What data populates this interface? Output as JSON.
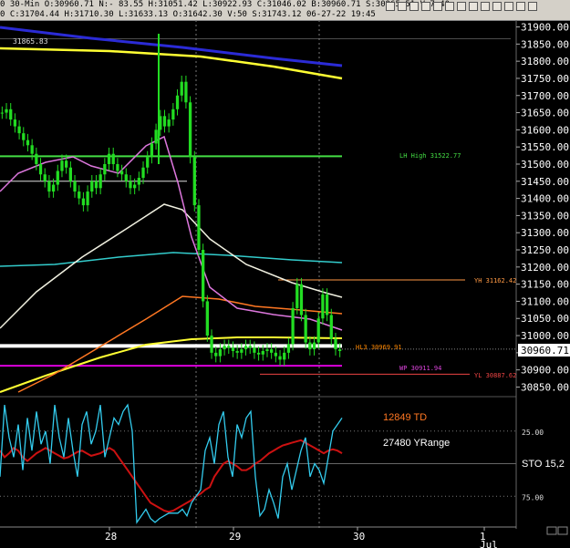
{
  "toolbar": {
    "quote_line": "0 30-Min O:30960.71 N:- 83.55 H:31051.42 L:30922.93 C:31046.02 B:30960.71 S:30965.51 V:7.40",
    "info_line": "0 C:31704.44 H:31710.30 L:31633.13 O:31642.30 V:50 S:31743.12 06-27-22 19:45",
    "icons": [
      "zoom-icon",
      "toggle-icon",
      "draw-icon",
      "color-icon",
      "check-icon",
      "clock-icon",
      "grid-icon",
      "text-icon",
      "cross-icon",
      "arrow-icon",
      "line-icon",
      "x-icon",
      "settings-icon"
    ]
  },
  "annotations": {
    "top_left_price": "31865.83",
    "lh_high": "LH High 31522.77",
    "yh": "YH 31162.42",
    "hl3": "HL3 30969.91",
    "wp": "WP 30911.94",
    "yl": "YL 30887.62",
    "td": "12849 TD",
    "yrange": "27480 YRange",
    "sto": "STO 15,2",
    "current_price": "30960.71"
  },
  "lower_ticks": [
    "25.00",
    "75.00"
  ],
  "x_labels": [
    "28",
    "29",
    "30",
    "1",
    "Jul"
  ],
  "colors": {
    "background": "#000000",
    "candle": "#22dd22",
    "blue_ma": "#2b2bd6",
    "yellow_ma": "#ffff33",
    "cyan_line": "#33cccc",
    "orange_ma": "#ff7722",
    "white_ma": "#f0f0e0",
    "pink_ma": "#dd77dd",
    "green_level": "#44dd44",
    "magenta_level": "#dd00dd",
    "hl3_orange": "#ff8800",
    "stoch_fast": "#33ccee",
    "stoch_slow": "#cc1111",
    "td_text": "#ff7722"
  },
  "chart_data": {
    "type": "line",
    "title": "",
    "y_ticks": [
      30850,
      30900,
      30950,
      31000,
      31050,
      31100,
      31150,
      31200,
      31250,
      31300,
      31350,
      31400,
      31450,
      31500,
      31550,
      31600,
      31650,
      31700,
      31750,
      31800,
      31850,
      31900
    ],
    "ylim": [
      30830,
      31920
    ],
    "x_categories": [
      "28",
      "29",
      "30",
      "1"
    ],
    "series": [
      {
        "kind": "close",
        "values": [
          31650,
          31660,
          31630,
          31610,
          31590,
          31570,
          31555,
          31530,
          31500,
          31470,
          31450,
          31420,
          31440,
          31480,
          31510,
          31490,
          31450,
          31420,
          31400,
          31380,
          31420,
          31450,
          31430,
          31470,
          31500,
          31530,
          31500,
          31480,
          31470,
          31450,
          31430,
          31440,
          31460,
          31490,
          31520,
          31560,
          31600,
          31640,
          31610,
          31630,
          31660,
          31700,
          31740,
          31680,
          31520,
          31380,
          31250,
          31100,
          31000,
          30950,
          30940,
          30960,
          30970,
          30965,
          30955,
          30950,
          30960,
          30970,
          30965,
          30950,
          30945,
          30955,
          30960,
          30950,
          30940,
          30930,
          30950,
          30975,
          31080,
          31150,
          31060,
          30980,
          30960,
          30980,
          31050,
          31120,
          31060,
          30990,
          30960,
          30955
        ]
      },
      {
        "kind": "level",
        "values": [
          31522.77
        ]
      },
      {
        "kind": "level",
        "values": [
          31162.42
        ]
      },
      {
        "kind": "level",
        "values": [
          30969.91
        ]
      },
      {
        "kind": "level",
        "values": [
          30911.94
        ]
      },
      {
        "kind": "level",
        "values": [
          30887.62
        ]
      },
      {
        "kind": "level",
        "values": [
          31865.83
        ]
      }
    ],
    "stochastic": {
      "ticks": [
        25,
        75
      ],
      "fast": [
        60,
        5,
        30,
        45,
        20,
        55,
        15,
        40,
        10,
        35,
        25,
        50,
        5,
        30,
        45,
        15,
        40,
        60,
        20,
        10,
        35,
        25,
        5,
        45,
        30,
        15,
        20,
        10,
        5,
        25,
        95,
        90,
        85,
        92,
        95,
        92,
        90,
        88,
        88,
        88,
        85,
        90,
        80,
        75,
        70,
        40,
        30,
        50,
        20,
        10,
        45,
        60,
        20,
        30,
        15,
        10,
        60,
        90,
        85,
        70,
        80,
        92,
        60,
        50,
        70,
        55,
        40,
        30,
        60,
        50,
        55,
        65,
        45,
        25,
        20,
        15
      ],
      "slow": [
        40,
        45,
        42,
        38,
        40,
        45,
        48,
        45,
        42,
        40,
        38,
        40,
        42,
        44,
        46,
        45,
        43,
        41,
        40,
        42,
        44,
        43,
        42,
        40,
        38,
        40,
        45,
        50,
        55,
        60,
        65,
        70,
        75,
        80,
        82,
        84,
        86,
        87,
        86,
        84,
        82,
        80,
        78,
        75,
        73,
        70,
        68,
        60,
        55,
        50,
        48,
        50,
        52,
        55,
        55,
        53,
        50,
        48,
        45,
        42,
        40,
        38,
        36,
        35,
        34,
        33,
        32,
        34,
        36,
        38,
        40,
        42,
        40,
        39,
        40,
        42
      ]
    }
  }
}
